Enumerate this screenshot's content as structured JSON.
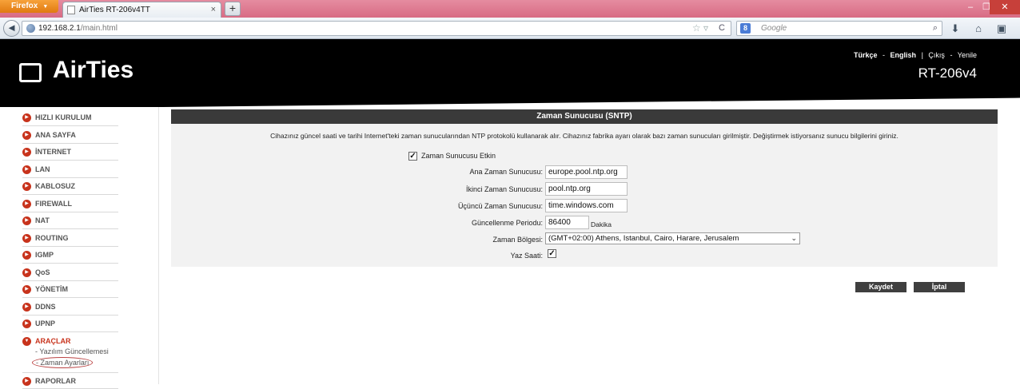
{
  "browser": {
    "app_button": "Firefox",
    "tab_title": "AirTies RT-206v4TT",
    "new_tab": "+",
    "url_host": "192.168.2.1",
    "url_path": "/main.html",
    "search_placeholder": "Google",
    "search_engine_badge": "8"
  },
  "header": {
    "logo": "AirTies",
    "lang_tr": "Türkçe",
    "lang_en": "English",
    "dash": "-",
    "pipe": "|",
    "logout": "Çıkış",
    "refresh": "Yenile",
    "model": "RT-206v4"
  },
  "sidebar": {
    "items": [
      {
        "label": "HIZLI KURULUM"
      },
      {
        "label": "ANA SAYFA"
      },
      {
        "label": "İNTERNET"
      },
      {
        "label": "LAN"
      },
      {
        "label": "KABLOSUZ"
      },
      {
        "label": "FIREWALL"
      },
      {
        "label": "NAT"
      },
      {
        "label": "ROUTING"
      },
      {
        "label": "IGMP"
      },
      {
        "label": "QoS"
      },
      {
        "label": "YÖNETİM"
      },
      {
        "label": "DDNS"
      },
      {
        "label": "UPNP"
      },
      {
        "label": "ARAÇLAR"
      },
      {
        "label": "RAPORLAR"
      }
    ],
    "sub_items": [
      {
        "label": "- Yazılım Güncellemesi"
      },
      {
        "label": "- Zaman Ayarları"
      }
    ]
  },
  "panel": {
    "title": "Zaman Sunucusu (SNTP)",
    "description": "Cihazınız güncel saati ve tarihi Internet'teki zaman sunucularından NTP protokolü kullanarak alır. Cihazınız fabrika ayarı olarak bazı zaman sunucuları girilmiştir. Değiştirmek istiyorsanız sunucu bilgilerini giriniz.",
    "enabled_label": "Zaman Sunucusu Etkin",
    "enabled_checked": true,
    "primary_label": "Ana Zaman Sunucusu:",
    "primary_value": "europe.pool.ntp.org",
    "secondary_label": "İkinci Zaman Sunucusu:",
    "secondary_value": "pool.ntp.org",
    "tertiary_label": "Üçüncü Zaman Sunucusu:",
    "tertiary_value": "time.windows.com",
    "period_label": "Güncellenme Periodu:",
    "period_value": "86400",
    "period_unit": "Dakika",
    "timezone_label": "Zaman Bölgesi:",
    "timezone_value": "(GMT+02:00) Athens, Istanbul, Cairo, Harare, Jerusalem",
    "dst_label": "Yaz Saati:",
    "dst_checked": true
  },
  "actions": {
    "save": "Kaydet",
    "cancel": "İptal"
  },
  "colors": {
    "accent": "#c8331c",
    "panel_header": "#3a3a3a",
    "title_bar": "#d86b84"
  }
}
